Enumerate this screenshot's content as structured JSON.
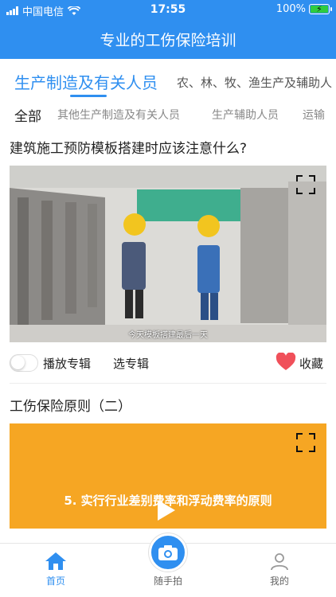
{
  "status_bar": {
    "carrier": "中国电信",
    "time": "17:55",
    "battery": "100%"
  },
  "header": {
    "title": "专业的工伤保险培训"
  },
  "primary_tabs": {
    "items": [
      {
        "label": "生产制造及有关人员",
        "active": true
      },
      {
        "label": "农、林、牧、渔生产及辅助人",
        "active": false
      }
    ]
  },
  "secondary_tabs": {
    "items": [
      {
        "label": "全部",
        "active": true
      },
      {
        "label": "其他生产制造及有关人员",
        "active": false
      },
      {
        "label": "生产辅助人员",
        "active": false
      },
      {
        "label": "运输",
        "active": false
      }
    ]
  },
  "videos": [
    {
      "title": "建筑施工预防模板搭建时应该注意什么?",
      "subtitle": "今天模板搭建最后一天",
      "fullscreen_icon": "fullscreen-icon"
    },
    {
      "title": "工伤保险原则（二）",
      "overlay_text": "5. 实行行业差别费率和浮动费率的原则",
      "fullscreen_icon": "fullscreen-icon",
      "play_icon": "play-icon"
    }
  ],
  "controls": {
    "play_album_label": "播放专辑",
    "select_album_label": "选专辑",
    "favorite_label": "收藏",
    "toggle_on": false
  },
  "tabbar": {
    "items": [
      {
        "label": "首页",
        "icon": "home-icon",
        "active": true
      },
      {
        "label": "随手拍",
        "icon": "camera-icon",
        "active": false
      },
      {
        "label": "我的",
        "icon": "user-icon",
        "active": false
      }
    ]
  },
  "colors": {
    "primary": "#2f8ff0",
    "favorite_heart": "#f0505a",
    "video2_bg": "#f6a623"
  }
}
